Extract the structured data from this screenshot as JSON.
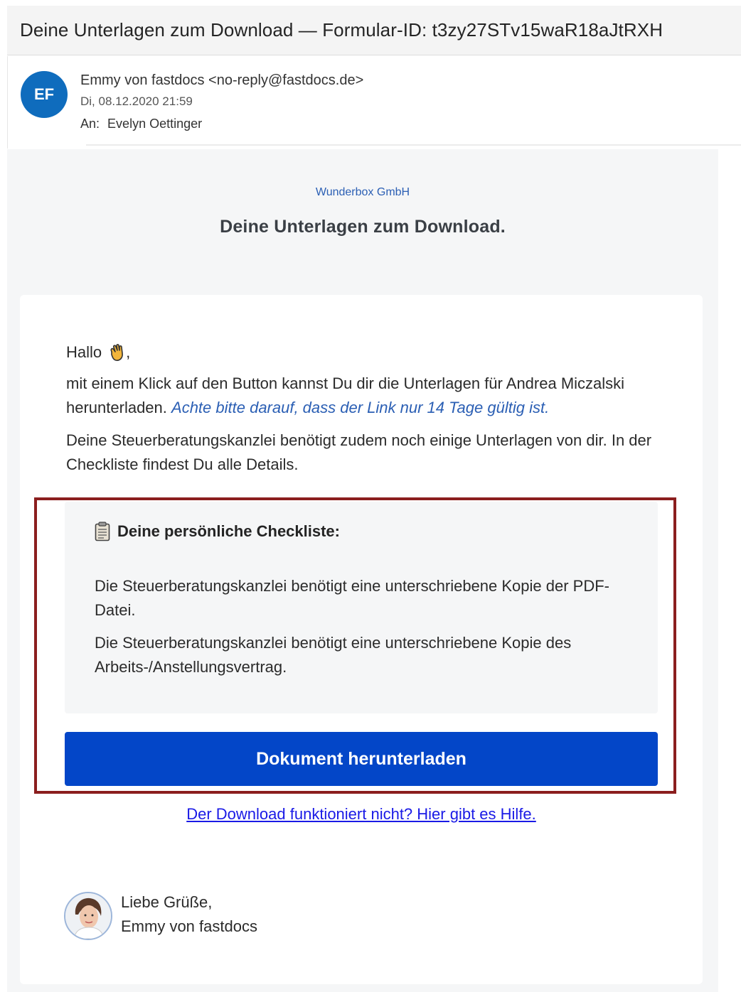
{
  "subject": "Deine Unterlagen zum Download — Formular-ID: t3zy27STv15waR18aJtRXH",
  "header": {
    "avatar_initials": "EF",
    "avatar_color": "#0f6cbd",
    "sender": "Emmy von fastdocs <no-reply@fastdocs.de>",
    "date": "Di, 08.12.2020 21:59",
    "to_label": "An:",
    "to_name": "Evelyn Oettinger"
  },
  "body": {
    "company": "Wunderbox GmbH",
    "tagline": "Deine Unterlagen zum Download.",
    "greeting": "Hallo",
    "greeting_suffix": ",",
    "greeting_icon": "waving-hand-icon",
    "intro": "mit einem Klick auf den Button kannst Du dir die Unterlagen für Andrea Miczalski herunterladen.",
    "intro_hint": "Achte bitte darauf, dass der Link nur 14 Tage gültig ist.",
    "office_text": "Deine Steuerberatungskanzlei benötigt zudem noch einige Unterlagen von dir. In der Checkliste findest Du alle Details.",
    "checklist": {
      "icon": "clipboard-icon",
      "title": "Deine persönliche Checkliste:",
      "items": [
        "Die Steuerberatungskanzlei benötigt eine unterschriebene Kopie der PDF-Datei.",
        "Die Steuerberatungskanzlei benötigt eine unterschriebene Kopie des Arbeits-/Anstellungsvertrag."
      ]
    },
    "download_button": "Dokument herunterladen",
    "button_color": "#0346c8",
    "help_link": "Der Download funktioniert nicht? Hier gibt es Hilfe.",
    "signature": {
      "greeting": "Liebe Grüße,",
      "name": "Emmy von fastdocs"
    },
    "highlight_color": "#8b1e1e"
  }
}
